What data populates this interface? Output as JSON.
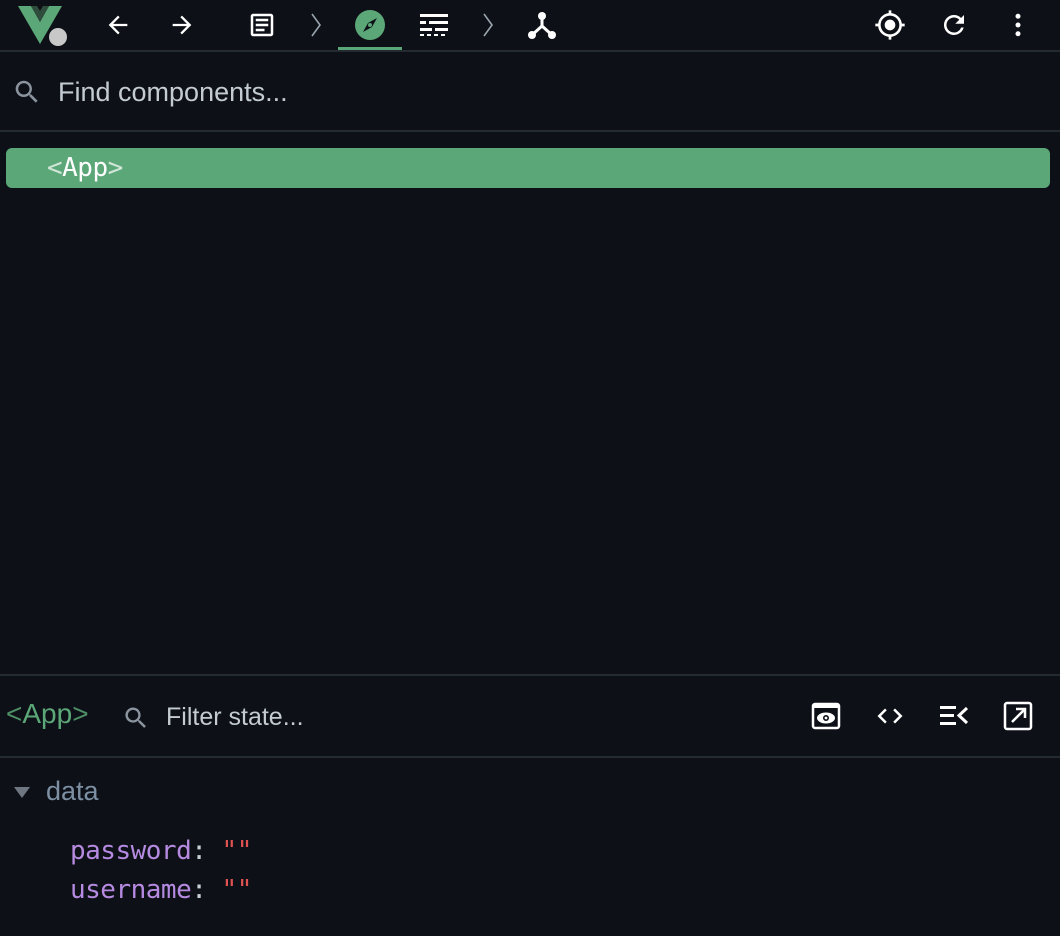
{
  "toolbar": {
    "icons": [
      "vue-logo",
      "back-arrow-icon",
      "forward-arrow-icon",
      "document-icon",
      "chevron-right-icon",
      "compass-icon",
      "timeline-icon",
      "chevron-right-icon",
      "fork-icon",
      "target-icon",
      "refresh-icon",
      "more-vertical-icon"
    ],
    "active_tab": "compass-icon",
    "colors": {
      "accent": "#5ba778",
      "icon": "#ffffff",
      "status_dot": "#c8c8c8"
    }
  },
  "search": {
    "placeholder": "Find components...",
    "value": ""
  },
  "tree": {
    "selected": {
      "open_bracket": "<",
      "name": "App",
      "close_bracket": ">"
    }
  },
  "inspector": {
    "title": {
      "open_bracket": "<",
      "name": "App",
      "close_bracket": ">"
    },
    "filter_placeholder": "Filter state...",
    "actions": [
      "eye-icon",
      "code-icon",
      "scroll-to-icon",
      "open-external-icon"
    ]
  },
  "state": {
    "section": "data",
    "expanded": true,
    "items": [
      {
        "key": "password",
        "colon": ":",
        "value": "\"\""
      },
      {
        "key": "username",
        "colon": ":",
        "value": "\"\""
      }
    ]
  },
  "colors": {
    "background": "#0d1117",
    "border": "#242a31",
    "key": "#b58ae0",
    "string_value": "#e05252",
    "section_label": "#7d8fa3"
  }
}
